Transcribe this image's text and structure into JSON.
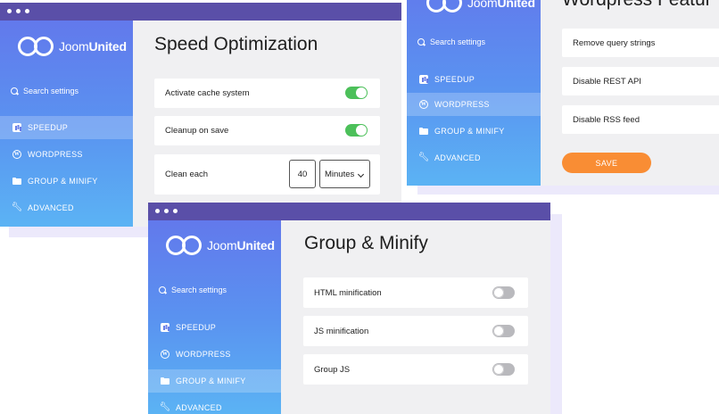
{
  "brand": {
    "light": "Joom",
    "bold": "United",
    "partial_light": "Joom",
    "partial_bold": "United"
  },
  "colors": {
    "titlebar": "#5a4fa8",
    "toggle_on": "#4cc05a",
    "toggle_off": "#b9b9bd",
    "save_button": "#f98d34",
    "content_bg": "#f0f0f2"
  },
  "sidebar": {
    "search_placeholder": "Search settings",
    "items": [
      {
        "label": "SPEEDUP",
        "icon": "chart-icon"
      },
      {
        "label": "WORDPRESS",
        "icon": "wordpress-icon"
      },
      {
        "label": "GROUP & MINIFY",
        "icon": "folder-icon"
      },
      {
        "label": "ADVANCED",
        "icon": "wrench-icon"
      }
    ]
  },
  "speed_window": {
    "title": "Speed Optimization",
    "active_nav": "SPEEDUP",
    "rows": [
      {
        "label": "Activate cache system",
        "toggle": true
      },
      {
        "label": "Cleanup on save",
        "toggle": true
      },
      {
        "label": "Clean each",
        "value": "40",
        "unit": "Minutes"
      }
    ]
  },
  "wordpress_window": {
    "title_partial": "Wordpress Featur",
    "active_nav": "WORDPRESS",
    "rows": [
      {
        "label": "Remove query strings"
      },
      {
        "label": "Disable REST API"
      },
      {
        "label": "Disable RSS feed"
      }
    ],
    "save_label": "SAVE"
  },
  "group_window": {
    "title": "Group & Minify",
    "active_nav": "GROUP & MINIFY",
    "rows": [
      {
        "label": "HTML minification",
        "toggle": false
      },
      {
        "label": "JS minification",
        "toggle": false
      },
      {
        "label": "Group JS",
        "toggle": false
      }
    ]
  }
}
